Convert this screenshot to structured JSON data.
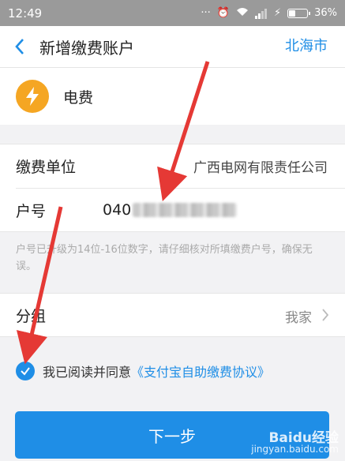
{
  "status_bar": {
    "time": "12:49",
    "battery": "36%"
  },
  "nav": {
    "title": "新增缴费账户",
    "city": "北海市"
  },
  "service": {
    "name": "电费",
    "icon": "lightning-icon",
    "icon_color": "#f5a623"
  },
  "form": {
    "unit_label": "缴费单位",
    "unit_value": "广西电网有限责任公司",
    "account_label": "户号",
    "account_value_visible": "040"
  },
  "hint": "户号已升级为14位-16位数字，请仔细核对所填缴费户号，确保无误。",
  "group": {
    "label": "分组",
    "value": "我家"
  },
  "agreement": {
    "text": "我已阅读并同意",
    "link": "《支付宝自助缴费协议》",
    "checked": true
  },
  "next_button": "下一步",
  "watermark": {
    "brand": "Baidu经验",
    "url": "jingyan.baidu.com"
  },
  "colors": {
    "accent": "#1f8ee6",
    "annotation": "#e53935"
  }
}
